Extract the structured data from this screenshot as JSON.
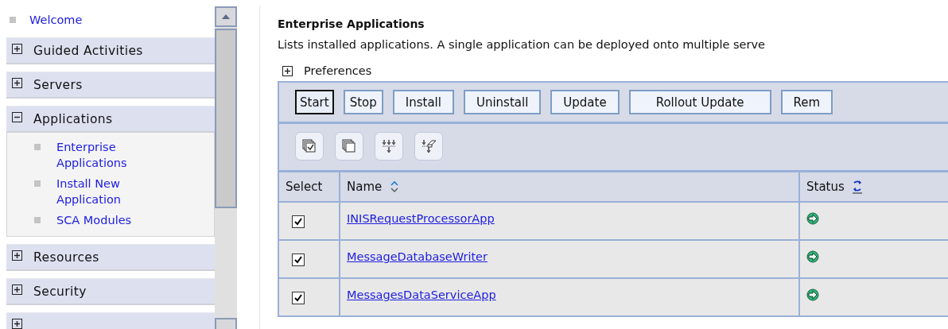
{
  "sidebar": {
    "welcome": "Welcome",
    "sections": [
      {
        "label": "Guided Activities",
        "expanded": false
      },
      {
        "label": "Servers",
        "expanded": false
      },
      {
        "label": "Applications",
        "expanded": true,
        "children": [
          "Enterprise Applications",
          "Install New Application",
          "SCA Modules"
        ]
      },
      {
        "label": "Resources",
        "expanded": false
      },
      {
        "label": "Security",
        "expanded": false
      },
      {
        "expanded": false
      }
    ]
  },
  "main": {
    "title": "Enterprise Applications",
    "description": "Lists installed applications. A single application can be deployed onto multiple serve",
    "preferences": {
      "label": "Preferences",
      "expanded": false
    },
    "buttons": [
      {
        "label": "Start",
        "focused": true
      },
      {
        "label": "Stop",
        "focused": false
      },
      {
        "label": "Install",
        "focused": false
      },
      {
        "label": "Uninstall",
        "focused": false
      },
      {
        "label": "Update",
        "focused": false
      },
      {
        "label": "Rollout Update",
        "focused": false
      },
      {
        "label": "Rem",
        "focused": false
      }
    ],
    "table": {
      "columns": [
        "Select",
        "Name",
        "Status"
      ],
      "rows": [
        {
          "name": "INISRequestProcessorApp",
          "checked": true,
          "started": true
        },
        {
          "name": "MessageDatabaseWriter",
          "checked": true,
          "started": true
        },
        {
          "name": "MessagesDataServiceApp",
          "checked": true,
          "started": true
        }
      ]
    }
  }
}
